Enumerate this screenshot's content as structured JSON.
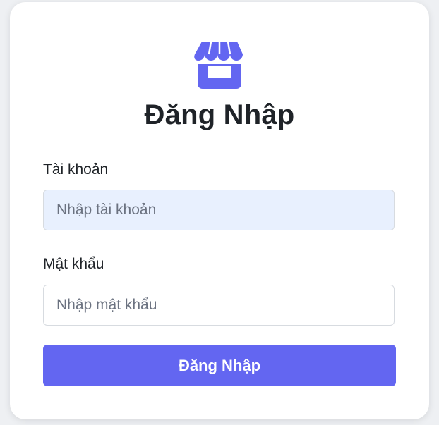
{
  "login": {
    "title": "Đăng Nhập",
    "brand_color": "#6366f1",
    "logo_icon": "store-icon",
    "username": {
      "label": "Tài khoản",
      "placeholder": "Nhập tài khoản",
      "value": ""
    },
    "password": {
      "label": "Mật khẩu",
      "placeholder": "Nhập mật khẩu",
      "value": ""
    },
    "submit_label": "Đăng Nhập"
  }
}
